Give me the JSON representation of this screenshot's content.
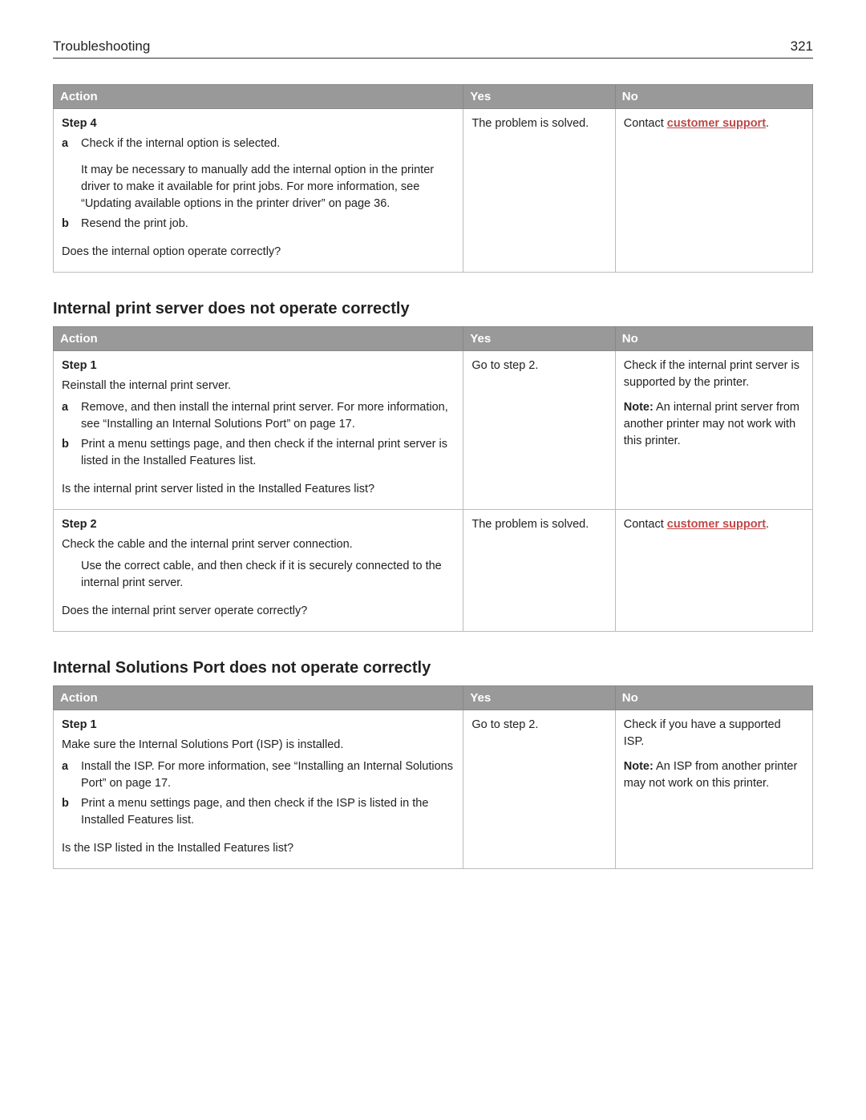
{
  "header": {
    "left": "Troubleshooting",
    "right": "321"
  },
  "columns": {
    "action": "Action",
    "yes": "Yes",
    "no": "No"
  },
  "table1": {
    "step4": {
      "title": "Step 4",
      "a_label": "a",
      "a_text": "Check if the internal option is selected.",
      "a_note": "It may be necessary to manually add the internal option in the printer driver to make it available for print jobs. For more information, see “Updating available options in the printer driver” on page 36.",
      "b_label": "b",
      "b_text": "Resend the print job.",
      "question": "Does the internal option operate correctly?",
      "yes": "The problem is solved.",
      "no_prefix": "Contact ",
      "no_link": "customer support",
      "no_suffix": "."
    }
  },
  "section2_title": "Internal print server does not operate correctly",
  "table2": {
    "step1": {
      "title": "Step 1",
      "intro": "Reinstall the internal print server.",
      "a_label": "a",
      "a_text": "Remove, and then install the internal print server. For more information, see “Installing an Internal Solutions Port” on page 17.",
      "b_label": "b",
      "b_text": "Print a menu settings page, and then check if the internal print server is listed in the Installed Features list.",
      "question": "Is the internal print server listed in the Installed Features list?",
      "yes": "Go to step 2.",
      "no_p1": "Check if the internal print server is supported by the printer.",
      "no_note_label": "Note:",
      "no_note_text": " An internal print server from another printer may not work with this printer."
    },
    "step2": {
      "title": "Step 2",
      "intro": "Check the cable and the internal print server connection.",
      "body": "Use the correct cable, and then check if it is securely connected to the internal print server.",
      "question": "Does the internal print server operate correctly?",
      "yes": "The problem is solved.",
      "no_prefix": "Contact ",
      "no_link": "customer support",
      "no_suffix": "."
    }
  },
  "section3_title": "Internal Solutions Port does not operate correctly",
  "table3": {
    "step1": {
      "title": "Step 1",
      "intro": "Make sure the Internal Solutions Port (ISP) is installed.",
      "a_label": "a",
      "a_text": "Install the ISP. For more information, see “Installing an Internal Solutions Port” on page 17.",
      "b_label": "b",
      "b_text": "Print a menu settings page, and then check if the ISP is listed in the Installed Features list.",
      "question": "Is the ISP listed in the Installed Features list?",
      "yes": "Go to step 2.",
      "no_p1": "Check if you have a supported ISP.",
      "no_note_label": "Note:",
      "no_note_text": " An ISP from another printer may not work on this printer."
    }
  }
}
